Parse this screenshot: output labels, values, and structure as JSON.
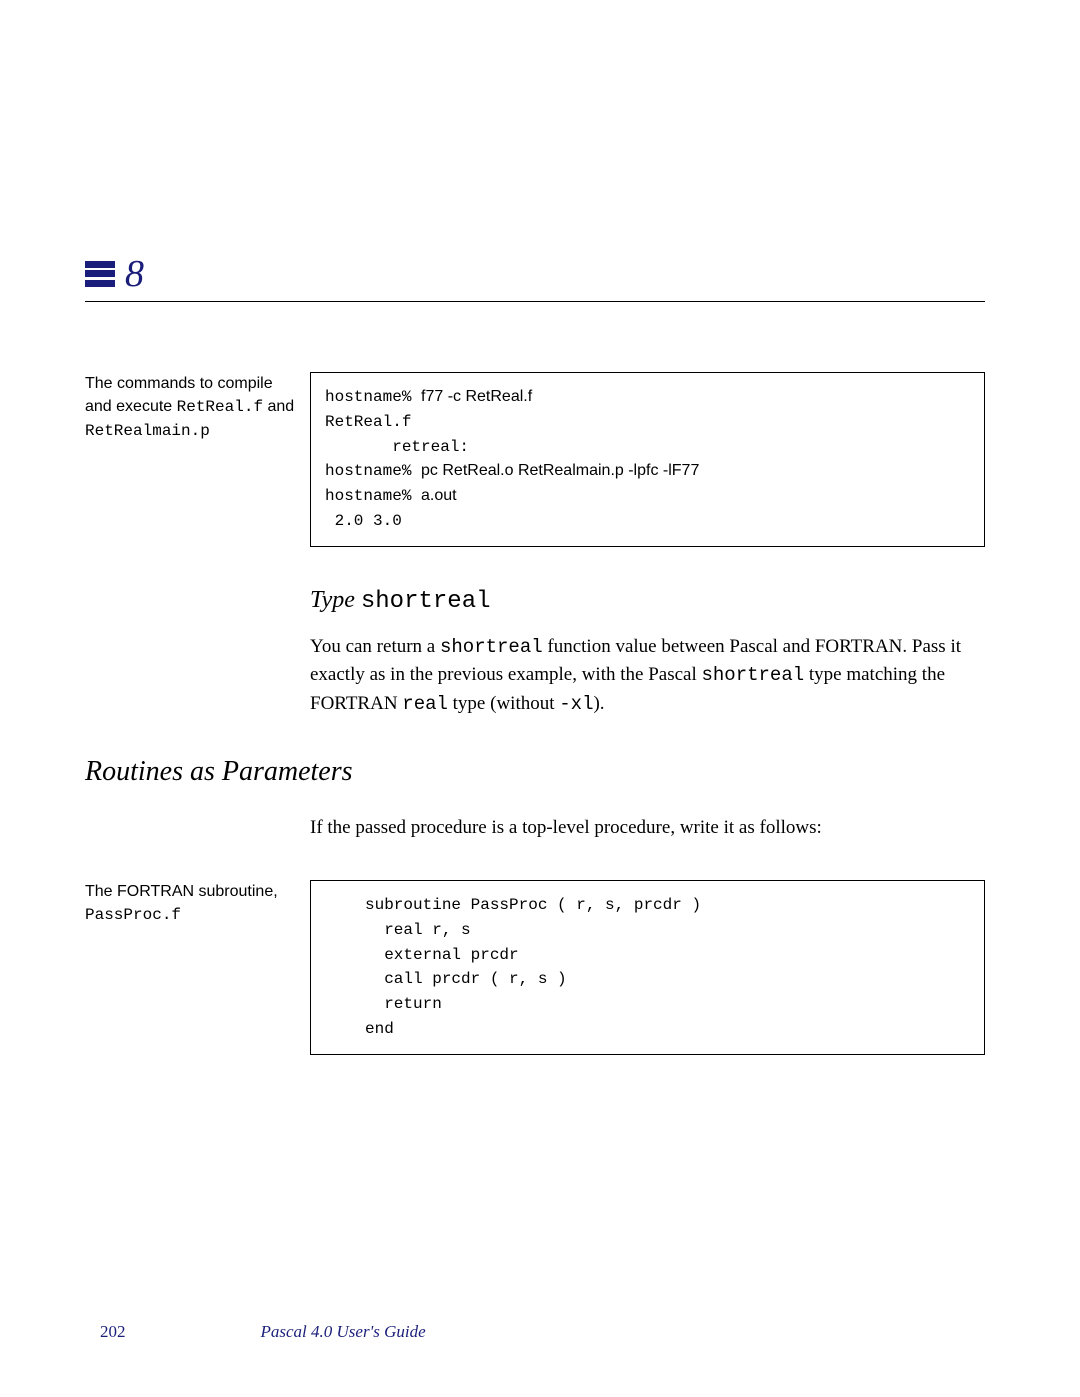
{
  "chapter": "8",
  "block1": {
    "sidebar_text1": "The commands to compile and execute ",
    "sidebar_code1": "RetReal.f",
    "sidebar_text2": " and ",
    "sidebar_code2": "RetRealmain.p",
    "lines": [
      {
        "prompt": "hostname% ",
        "cmd": "f77 -c RetReal.f"
      },
      {
        "text": "RetReal.f"
      },
      {
        "text": "       retreal:"
      },
      {
        "prompt": "hostname% ",
        "cmd": "pc RetReal.o RetRealmain.p -lpfc -lF77"
      },
      {
        "prompt": "hostname% ",
        "cmd": "a.out"
      },
      {
        "text": " 2.0 3.0"
      }
    ]
  },
  "subhead": {
    "label": "Type ",
    "code": "shortreal"
  },
  "para1": {
    "t1": "You can return a ",
    "c1": "shortreal",
    "t2": " function value between Pascal and FORTRAN. Pass it exactly as in the previous example, with the Pascal ",
    "c2": "shortreal",
    "t3": " type matching the FORTRAN ",
    "c3": "real",
    "t4": " type (without ",
    "c4": "-xl",
    "t5": ")."
  },
  "section_head": "Routines as Parameters",
  "para2": "If the passed procedure is a top-level procedure, write it as follows:",
  "block2": {
    "sidebar_text1": "The FORTRAN subroutine, ",
    "sidebar_code1": "PassProc.f",
    "code": "subroutine PassProc ( r, s, prcdr )\n  real r, s\n  external prcdr\n  call prcdr ( r, s )\n  return\nend"
  },
  "footer": {
    "page": "202",
    "title": "Pascal 4.0 User's Guide"
  }
}
